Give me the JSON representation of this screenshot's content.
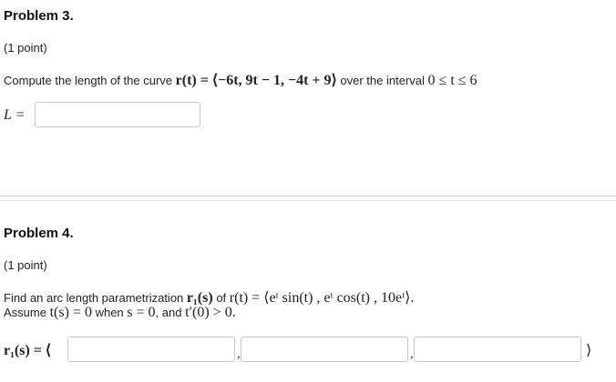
{
  "problem3": {
    "title": "Problem 3.",
    "points": "(1 point)",
    "prompt_text": "Compute the length of the curve",
    "curve_expr": "r(t) = ⟨−6t, 9t − 1, −4t + 9⟩",
    "interval_text": "over the interval",
    "interval_expr": "0 ≤ t ≤ 6",
    "answer_label": "L =",
    "answer_value": ""
  },
  "problem4": {
    "title": "Problem 4.",
    "points": "(1 point)",
    "prompt_text": "Find an arc length parametrization",
    "r1_expr": "r₁(s)",
    "of_text": "of",
    "curve_expr": "r(t) = ⟨eᵗ sin(t) , eᵗ cos(t) , 10eᵗ⟩.",
    "assume_text": "Assume",
    "t_s_expr": "t(s) = 0",
    "when_text": "when",
    "s_expr": "s = 0",
    "and_text": ", and",
    "tprime_expr": "t′(0) > 0.",
    "answer_label": "r₁(s) = ⟨",
    "answer_close": "⟩",
    "answers": [
      "",
      "",
      ""
    ]
  }
}
